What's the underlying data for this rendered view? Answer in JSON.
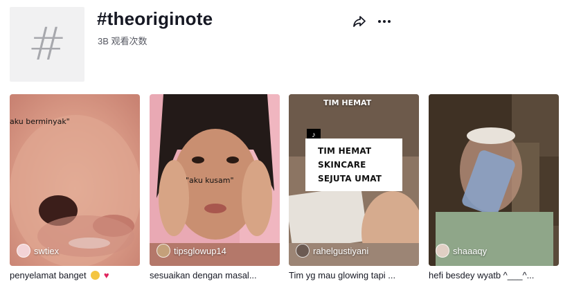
{
  "header": {
    "tag_symbol": "#",
    "title": "#theoriginote",
    "views": "3B 观看次数",
    "share_icon": "share-icon",
    "more_icon": "more-icon"
  },
  "videos": [
    {
      "author": "swtiex",
      "caption": "penyelamat banget",
      "overlay": "aku berminyak\""
    },
    {
      "author": "tipsglowup14",
      "caption": "sesuaikan dengan masal...",
      "overlay": "\"aku kusam\""
    },
    {
      "author": "rahelgustiyani",
      "caption": "Tim yg mau glowing tapi ...",
      "top_overlay": "TIM HEMAT",
      "box_lines": [
        "TIM HEMAT",
        "SKINCARE",
        "SEJUTA UMAT"
      ]
    },
    {
      "author": "shaaaqy",
      "caption": "hefi besdey wyatb ^___^..."
    }
  ]
}
